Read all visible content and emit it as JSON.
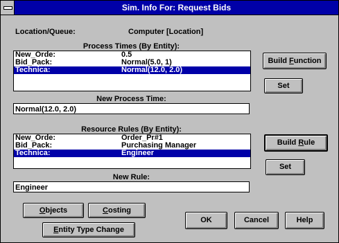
{
  "window": {
    "title": "Sim. Info For:  Request Bids"
  },
  "location": {
    "label": "Location/Queue:",
    "value": "Computer  [Location]"
  },
  "process_times": {
    "heading": "Process Times (By Entity):",
    "rows": [
      {
        "entity": "New_Orde:",
        "value": "0.5",
        "selected": false
      },
      {
        "entity": "Bid_Pack:",
        "value": "Normal(5.0, 1)",
        "selected": false
      },
      {
        "entity": "Technica:",
        "value": "Normal(12.0, 2.0)",
        "selected": true
      }
    ]
  },
  "new_process_time": {
    "label": "New Process Time:",
    "value": "Normal(12.0, 2.0)"
  },
  "resource_rules": {
    "heading": "Resource Rules (By Entity):",
    "rows": [
      {
        "entity": "New_Orde:",
        "value": "Order_Pr#1",
        "selected": false
      },
      {
        "entity": "Bid_Pack:",
        "value": "Purchasing Manager",
        "selected": false
      },
      {
        "entity": "Technica:",
        "value": "Engineer",
        "selected": true
      }
    ]
  },
  "new_rule": {
    "label": "New Rule:",
    "value": "Engineer"
  },
  "buttons": {
    "build_function": {
      "pre": "Build ",
      "u": "F",
      "post": "unction"
    },
    "set_1": {
      "pre": "Se",
      "u": "",
      "post": "t"
    },
    "build_rule": {
      "pre": "Build ",
      "u": "R",
      "post": "ule"
    },
    "set_2": {
      "pre": "Set",
      "u": "",
      "post": ""
    },
    "objects": {
      "pre": "",
      "u": "O",
      "post": "bjects"
    },
    "costing": {
      "pre": "",
      "u": "C",
      "post": "osting"
    },
    "entity_type_change": {
      "pre": "",
      "u": "E",
      "post": "ntity Type Change"
    },
    "ok": {
      "pre": "OK",
      "u": "",
      "post": ""
    },
    "cancel": {
      "pre": "Cancel",
      "u": "",
      "post": ""
    },
    "help": {
      "pre": "Help",
      "u": "",
      "post": ""
    }
  },
  "colors": {
    "titlebar": "#0000a8",
    "selection": "#0000a8",
    "face": "#c0c0c0"
  }
}
